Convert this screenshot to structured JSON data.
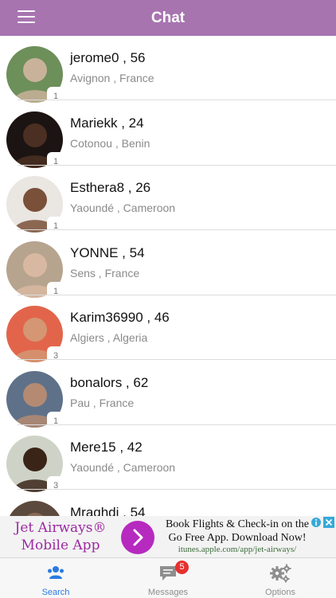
{
  "header": {
    "title": "Chat"
  },
  "contacts": [
    {
      "name": "jerome0 , 56",
      "location": "Avignon , France",
      "count": "1",
      "avatar_bg": "#6d8f5a",
      "avatar_fg": "#c9b29a"
    },
    {
      "name": "Mariekk , 24",
      "location": "Cotonou , Benin",
      "count": "1",
      "avatar_bg": "#1c1412",
      "avatar_fg": "#4a2f22"
    },
    {
      "name": "Esthera8 , 26",
      "location": "Yaoundé , Cameroon",
      "count": "1",
      "avatar_bg": "#eae6e2",
      "avatar_fg": "#7a5038"
    },
    {
      "name": "YONNE , 54",
      "location": "Sens , France",
      "count": "1",
      "avatar_bg": "#b7a48f",
      "avatar_fg": "#d9b8a1"
    },
    {
      "name": "Karim36990 , 46",
      "location": "Algiers , Algeria",
      "count": "3",
      "avatar_bg": "#e2654b",
      "avatar_fg": "#d49673"
    },
    {
      "name": "bonalors , 62",
      "location": "Pau , France",
      "count": "1",
      "avatar_bg": "#5e7189",
      "avatar_fg": "#b48a72"
    },
    {
      "name": "Mere15 , 42",
      "location": "Yaoundé , Cameroon",
      "count": "3",
      "avatar_bg": "#cfd3c7",
      "avatar_fg": "#3a2418"
    },
    {
      "name": "Mraghdi , 54",
      "location": "",
      "count": "",
      "avatar_bg": "#5d4a3e",
      "avatar_fg": "#8a6a55"
    }
  ],
  "ad": {
    "brand_line1": "Jet Airways®",
    "brand_line2": "Mobile App",
    "headline": "Book Flights & Check-in on the Go Free App. Download Now!",
    "url": "itunes.apple.com/app/jet-airways/",
    "accent": "#b62ac0"
  },
  "tabs": [
    {
      "label": "Search",
      "icon": "people-icon",
      "active": true
    },
    {
      "label": "Messages",
      "icon": "chat-bubble-icon",
      "badge": "5"
    },
    {
      "label": "Options",
      "icon": "gears-icon"
    }
  ],
  "colors": {
    "header": "#a774b0",
    "active_tab": "#2a7ae2",
    "badge": "#e5312f"
  }
}
